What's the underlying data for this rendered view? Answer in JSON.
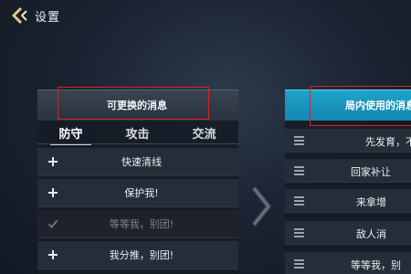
{
  "header": {
    "back_icon": "chevron-left-icon",
    "title": "设置"
  },
  "left_panel": {
    "title": "可更换的消息",
    "tabs": [
      {
        "label": "防守",
        "active": true
      },
      {
        "label": "攻击",
        "active": false
      },
      {
        "label": "交流",
        "active": false
      }
    ],
    "messages": [
      {
        "text": "快速清线",
        "icon": "plus-icon",
        "enabled": true
      },
      {
        "text": "保护我!",
        "icon": "plus-icon",
        "enabled": true
      },
      {
        "text": "等等我，别团!",
        "icon": "check-icon",
        "enabled": false
      },
      {
        "text": "我分推，别团!",
        "icon": "plus-icon",
        "enabled": true
      }
    ]
  },
  "right_panel": {
    "title": "局内使用的消息",
    "messages": [
      {
        "text": "先发育，不",
        "icon": "drag-handle-icon"
      },
      {
        "text": "回家补让",
        "icon": "drag-handle-icon"
      },
      {
        "text": "来拿增",
        "icon": "drag-handle-icon"
      },
      {
        "text": "敌人消",
        "icon": "drag-handle-icon"
      },
      {
        "text": "等等我，别",
        "icon": "drag-handle-icon"
      }
    ]
  },
  "colors": {
    "highlight": "#e02020",
    "right_header": "#1a98c0",
    "active_tab_underline": "#c9d3dc"
  }
}
